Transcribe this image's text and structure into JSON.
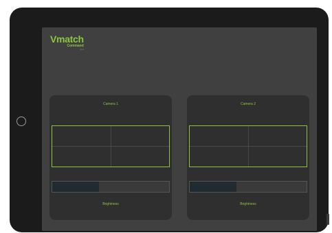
{
  "app": {
    "logo_title": "Vmatch",
    "logo_subtitle": "Command",
    "logo_version": "v1.0"
  },
  "cameras": [
    {
      "title": "Camera 1",
      "slider_label": "Brightness",
      "brightness": 0.4
    },
    {
      "title": "Camera 2",
      "slider_label": "Brightness",
      "brightness": 0.4
    }
  ],
  "colors": {
    "accent": "#8cc63f",
    "screen_background": "#404040",
    "panel_background": "#2f2f2f",
    "slider_fill": "#1f2a31"
  }
}
